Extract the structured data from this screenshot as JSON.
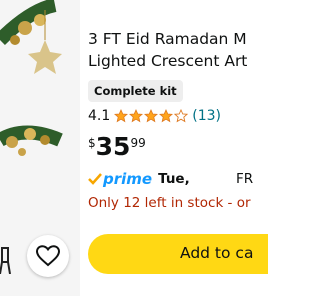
{
  "product": {
    "title_line1": "3 FT Eid Ramadan M",
    "title_line2": "Lighted Crescent Art",
    "badge": "Complete kit",
    "rating_value": "4.1",
    "rating_stars": 4.1,
    "rating_count": "(13)",
    "price": {
      "currency": "$",
      "whole": "35",
      "fraction": "99"
    },
    "prime": {
      "label": "prime",
      "delivery": "Tue,",
      "extra": "FR"
    },
    "stock_text": "Only 12 left in stock - or",
    "add_to_cart_label": "Add to ca"
  },
  "colors": {
    "accent": "#1399ff",
    "stock": "#b12704",
    "cart_button": "#ffd814",
    "link": "#007185",
    "star": "#ffa41c"
  },
  "icons": {
    "favorite": "heart-icon",
    "prime": "prime-check-icon",
    "star": "star-icon"
  }
}
